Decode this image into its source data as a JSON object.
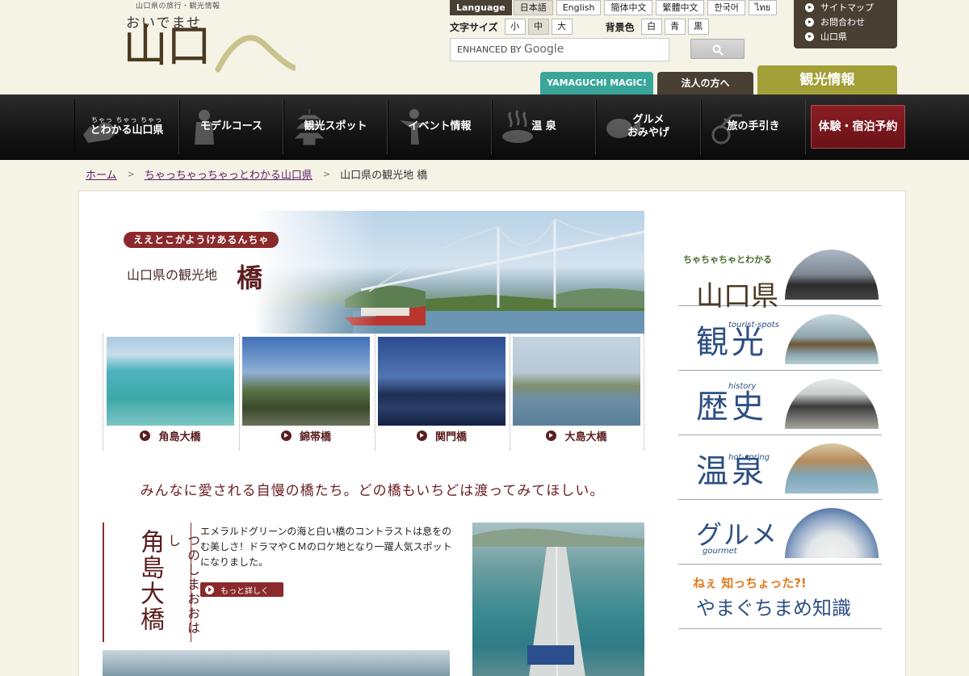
{
  "header": {
    "logo_tagline": "山口県の旅行・観光情報",
    "logo_sub": "おいでませ",
    "logo_main": "山口",
    "language_label": "Language",
    "languages": [
      "日本語",
      "English",
      "簡体中文",
      "繁體中文",
      "한국어",
      "ไทย"
    ],
    "font_size_label": "文字サイズ",
    "font_sizes": [
      "小",
      "中",
      "大"
    ],
    "bg_label": "背景色",
    "bg_colors": [
      "白",
      "青",
      "黒"
    ],
    "search_placeholder": "ENHANCED BY",
    "search_brand": "Google",
    "utility_links": [
      "サイトマップ",
      "お問合わせ",
      "山口県"
    ],
    "tabs": {
      "magic": "YAMAGUCHI MAGIC!",
      "corporate": "法人の方へ",
      "tourism": "観光情報"
    }
  },
  "nav": {
    "items": [
      {
        "ruby": "ちゃっ ちゃっ ちゃっ",
        "label": "とわかる山口県"
      },
      {
        "label": "モデルコース"
      },
      {
        "label": "観光スポット"
      },
      {
        "label": "イベント情報"
      },
      {
        "label": "温 泉"
      },
      {
        "label": "グルメ\nおみやげ"
      },
      {
        "label": "旅の手引き"
      }
    ],
    "booking": "体験・宿泊予約"
  },
  "breadcrumb": {
    "home": "ホーム",
    "parent": "ちゃっちゃっちゃっとわかる山口県",
    "current": "山口県の観光地 橋"
  },
  "hero": {
    "ribbon": "ええとこがようけあるんちゃ",
    "subtitle": "山口県の観光地",
    "title": "橋"
  },
  "bridges": [
    "角島大橋",
    "錦帯橋",
    "関門橋",
    "大島大橋"
  ],
  "catchphrase": "みんなに愛される自慢の橋たち。どの橋もいちどは渡ってみてほしい。",
  "detail": {
    "title": "角島大橋",
    "ruby": "つのしまおおはし",
    "text": "エメラルドグリーンの海と白い橋のコントラストは息をのむ美しさ！ドラマやＣＭのロケ地となり一躍人気スポットになりました。",
    "more": "もっと詳しく"
  },
  "sidebar": {
    "items": [
      {
        "top": "ちゃちゃちゃとわかる",
        "big": "山口県"
      },
      {
        "big": "観光",
        "small": "tourist-spots"
      },
      {
        "big": "歴史",
        "small": "history"
      },
      {
        "big": "温泉",
        "small": "hot-spring"
      },
      {
        "big": "グルメ",
        "small": "gourmet"
      },
      {
        "top": "ねぇ 知っちょった?!",
        "big": "やまぐちまめ知識"
      }
    ]
  },
  "colors": {
    "nav_bg": "#141414",
    "accent_red": "#8b2a2c",
    "olive": "#a39f37",
    "teal": "#3aa69a",
    "brown": "#4a3f33",
    "navy": "#2d4f82"
  }
}
